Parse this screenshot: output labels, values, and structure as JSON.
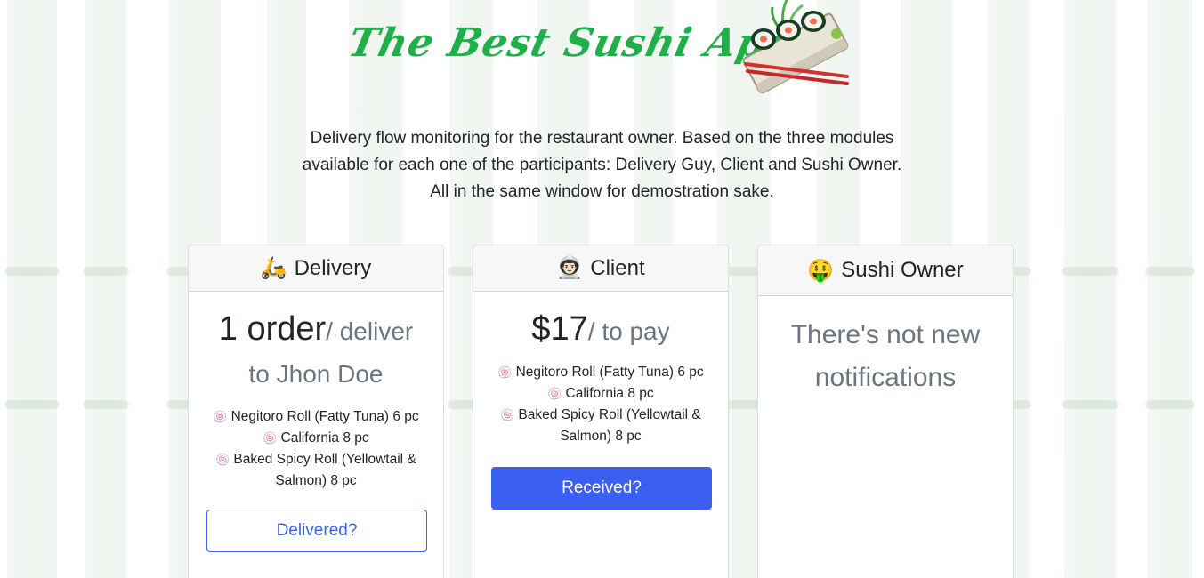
{
  "header": {
    "app_title": "The Best Sushi App",
    "intro": "Delivery flow monitoring for the restaurant owner. Based on the three modules available for each one of the participants: Delivery Guy, Client and Sushi Owner. All in the same window for demostration sake."
  },
  "colors": {
    "brand_green": "#1fb04a",
    "primary_blue": "#3b5ff0"
  },
  "cards": {
    "delivery": {
      "icon": "scooter-icon",
      "emoji": "🛵",
      "title": "Delivery",
      "amount": "1 order",
      "amount_suffix": "/ deliver to Jhon Doe",
      "items": [
        "Negitoro Roll (Fatty Tuna) 6 pc",
        "California 8 pc",
        "Baked Spicy Roll (Yellowtail & Salmon) 8 pc"
      ],
      "item_icon": "🍥",
      "button_label": "Delivered?"
    },
    "client": {
      "icon": "astronaut-icon",
      "emoji": "👨🏻‍🚀",
      "title": "Client",
      "amount": "$17",
      "amount_suffix": "/ to pay",
      "items": [
        "Negitoro Roll (Fatty Tuna) 6 pc",
        "California 8 pc",
        "Baked Spicy Roll (Yellowtail & Salmon) 8 pc"
      ],
      "item_icon": "🍥",
      "button_label": "Received?"
    },
    "owner": {
      "icon": "money-mouth-face-icon",
      "emoji": "🤑",
      "title": "Sushi Owner",
      "message": "There's not new notifications"
    }
  }
}
